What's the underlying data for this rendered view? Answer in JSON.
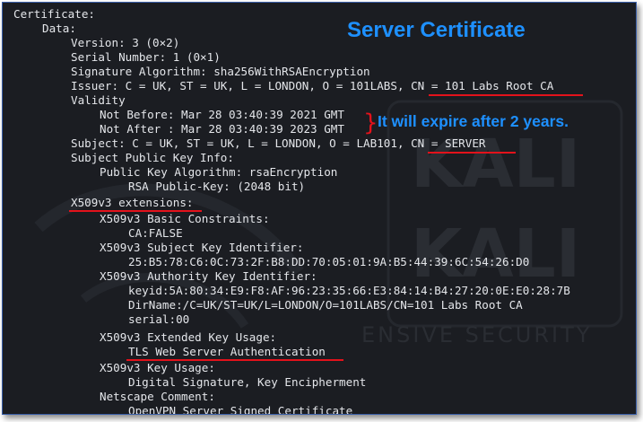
{
  "lines": [
    "Certificate:",
    "Data:",
    "Version: 3 (0×2)",
    "Serial Number: 1 (0×1)",
    "Signature Algorithm: sha256WithRSAEncryption",
    "Issuer: C = UK, ST = UK, L = LONDON, O = 101LABS, CN = 101 Labs Root CA",
    "Validity",
    "Not Before: Mar 28 03:40:39 2021 GMT",
    "Not After : Mar 28 03:40:39 2023 GMT",
    "Subject: C = UK, ST = UK, L = LONDON, O = LAB101, CN = SERVER",
    "Subject Public Key Info:",
    "Public Key Algorithm: rsaEncryption",
    "RSA Public-Key: (2048 bit)",
    "X509v3 extensions:",
    "X509v3 Basic Constraints:",
    "CA:FALSE",
    "X509v3 Subject Key Identifier:",
    "25:B5:78:C6:0C:73:2F:B8:DD:70:05:01:9A:B5:44:39:6C:54:26:D0",
    "X509v3 Authority Key Identifier:",
    "keyid:5A:80:34:E9:F8:AF:96:23:35:66:E3:84:14:B4:27:20:0E:E0:28:7B",
    "DirName:/C=UK/ST=UK/L=LONDON/O=101LABS/CN=101 Labs Root CA",
    "serial:00",
    "X509v3 Extended Key Usage:",
    "TLS Web Server Authentication",
    "X509v3 Key Usage:",
    "Digital Signature, Key Encipherment",
    "Netscape Comment:",
    "OpenVPN Server Signed Certificate"
  ],
  "annotations": {
    "title": "Server Certificate",
    "expiry_note": "It will expire after 2 years.",
    "brace": "}"
  },
  "watermark": {
    "brand": "KALI",
    "tagline": "ENSIVE SECURITY"
  },
  "colors": {
    "terminal_background": "#1b1d22",
    "text": "#e4e6ea",
    "annotation_blue": "#1e90ff",
    "underline_red": "#e3121b"
  }
}
